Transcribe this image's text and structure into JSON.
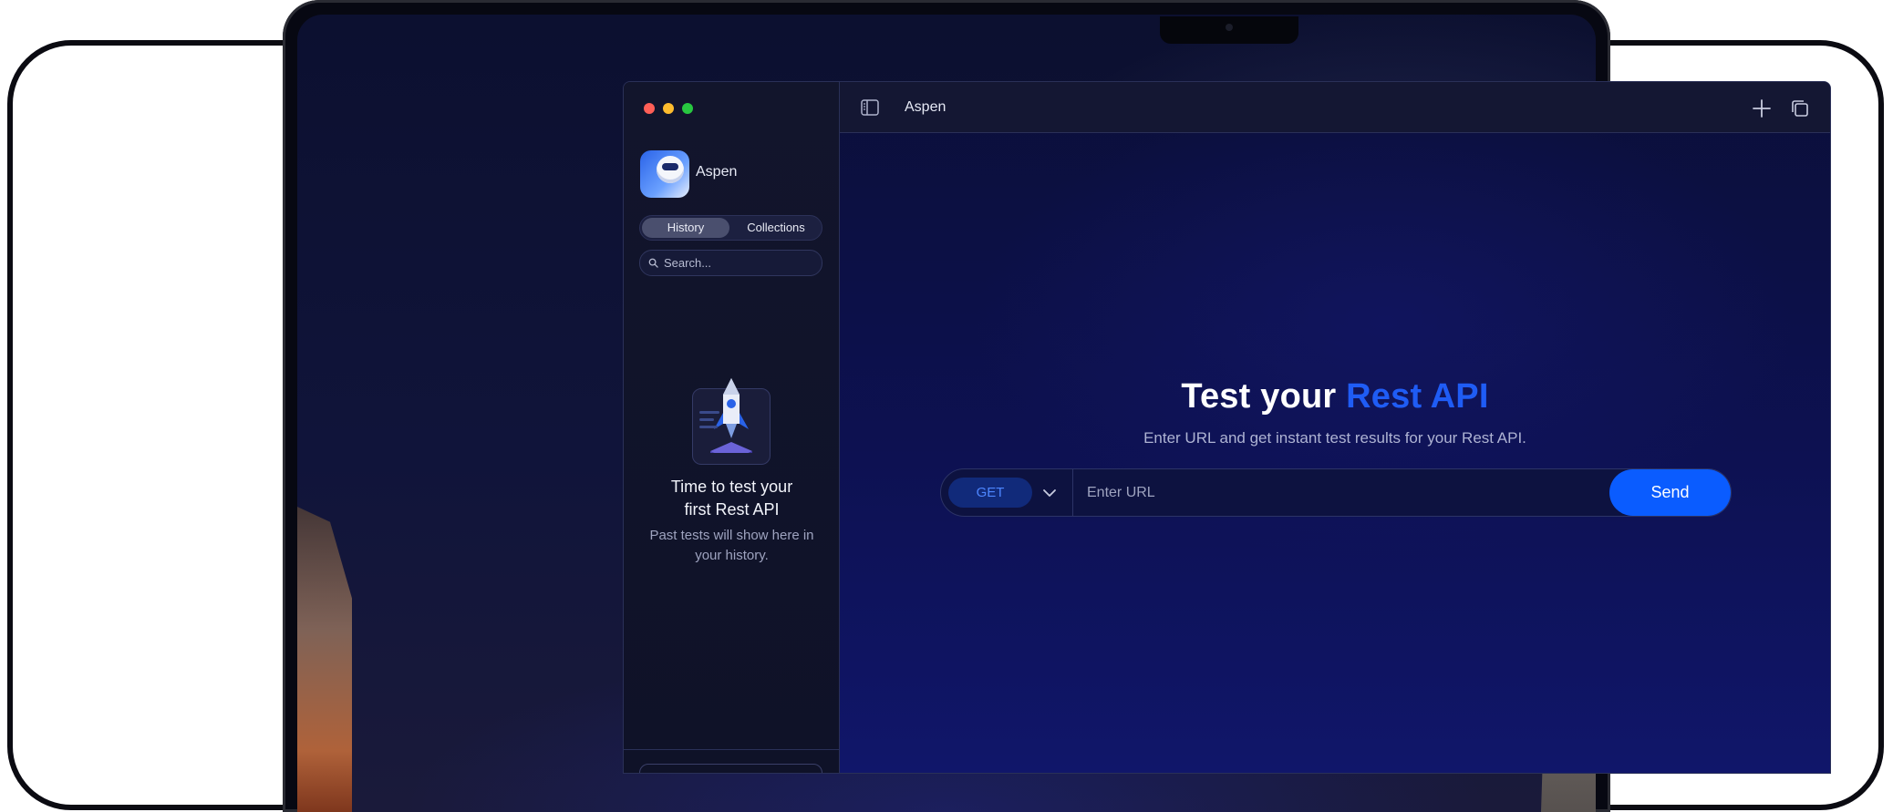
{
  "window": {
    "traffic_lights": [
      "close",
      "minimize",
      "zoom"
    ]
  },
  "sidebar": {
    "app_name": "Aspen",
    "tabs": [
      {
        "label": "History",
        "active": true
      },
      {
        "label": "Collections",
        "active": false
      }
    ],
    "search": {
      "placeholder": "Search..."
    },
    "empty_state": {
      "title": "Time to test your first Rest API",
      "subtitle": "Past tests will show here in your history."
    }
  },
  "topbar": {
    "tab_title": "Aspen",
    "icons": [
      "sidebar-toggle-icon",
      "plus-icon",
      "windows-icon"
    ]
  },
  "main": {
    "title_prefix": "Test your ",
    "title_accent": "Rest API",
    "subtitle": "Enter URL and get instant test results for your Rest API.",
    "request": {
      "method": "GET",
      "url_value": "",
      "url_placeholder": "Enter URL",
      "send_label": "Send"
    }
  },
  "colors": {
    "accent": "#0a5cff",
    "title_accent": "#1f5cf5",
    "background": "#0c1035"
  }
}
